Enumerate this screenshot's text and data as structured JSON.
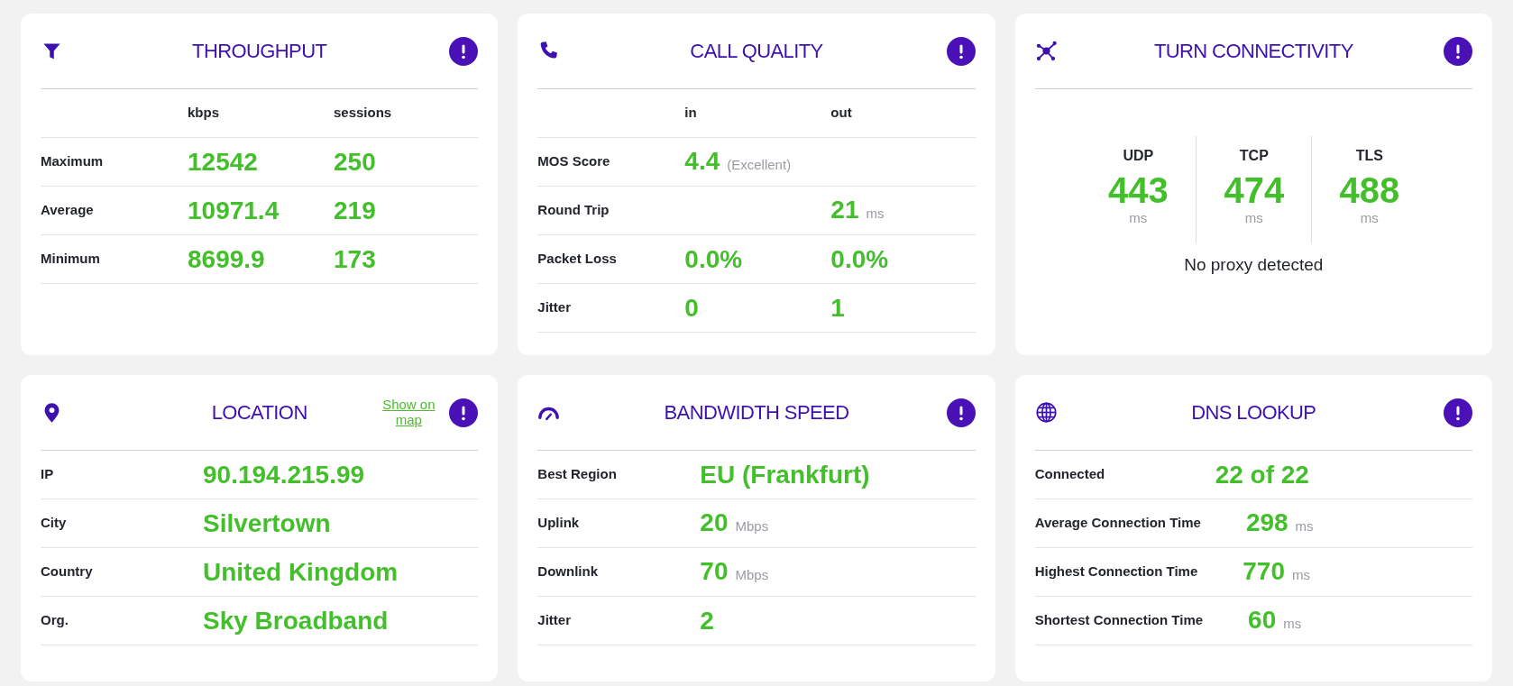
{
  "cards": [
    {
      "kind": "table",
      "title": "THROUGHPUT",
      "columns": [
        "kbps",
        "sessions"
      ],
      "rows": [
        {
          "label": "Maximum",
          "cells": [
            {
              "value": "12542"
            },
            {
              "value": "250"
            }
          ]
        },
        {
          "label": "Average",
          "cells": [
            {
              "value": "10971.4"
            },
            {
              "value": "219"
            }
          ]
        },
        {
          "label": "Minimum",
          "cells": [
            {
              "value": "8699.9"
            },
            {
              "value": "173"
            }
          ]
        }
      ]
    },
    {
      "kind": "table",
      "title": "CALL QUALITY",
      "columns": [
        "in",
        "out"
      ],
      "rows": [
        {
          "label": "MOS Score",
          "cells": [
            {
              "value": "4.4",
              "note": "(Excellent)"
            },
            null
          ]
        },
        {
          "label": "Round Trip",
          "cells": [
            null,
            {
              "value": "21",
              "unit": "ms"
            }
          ]
        },
        {
          "label": "Packet Loss",
          "cells": [
            {
              "value": "0.0%"
            },
            {
              "value": "0.0%"
            }
          ]
        },
        {
          "label": "Jitter",
          "cells": [
            {
              "value": "0"
            },
            {
              "value": "1"
            }
          ]
        }
      ]
    },
    {
      "kind": "protocols",
      "title": "TURN CONNECTIVITY",
      "protocols": [
        {
          "name": "UDP",
          "value": "443",
          "unit": "ms"
        },
        {
          "name": "TCP",
          "value": "474",
          "unit": "ms"
        },
        {
          "name": "TLS",
          "value": "488",
          "unit": "ms"
        }
      ],
      "footer": "No proxy detected"
    },
    {
      "kind": "details",
      "title": "LOCATION",
      "link": "Show on map",
      "rows": [
        {
          "label": "IP",
          "value": "90.194.215.99"
        },
        {
          "label": "City",
          "value": "Silvertown"
        },
        {
          "label": "Country",
          "value": "United Kingdom"
        },
        {
          "label": "Org.",
          "value": "Sky Broadband"
        }
      ]
    },
    {
      "kind": "details",
      "title": "BANDWIDTH SPEED",
      "rows": [
        {
          "label": "Best Region",
          "value": "EU (Frankfurt)"
        },
        {
          "label": "Uplink",
          "value": "20",
          "unit": "Mbps"
        },
        {
          "label": "Downlink",
          "value": "70",
          "unit": "Mbps"
        },
        {
          "label": "Jitter",
          "value": "2"
        }
      ]
    },
    {
      "kind": "details",
      "title": "DNS LOOKUP",
      "rows": [
        {
          "label": "Connected",
          "value": "22 of 22"
        },
        {
          "label": "Average Connection Time",
          "value": "298",
          "unit": "ms"
        },
        {
          "label": "Highest Connection Time",
          "value": "770",
          "unit": "ms"
        },
        {
          "label": "Shortest Connection Time",
          "value": "60",
          "unit": "ms"
        }
      ]
    }
  ]
}
